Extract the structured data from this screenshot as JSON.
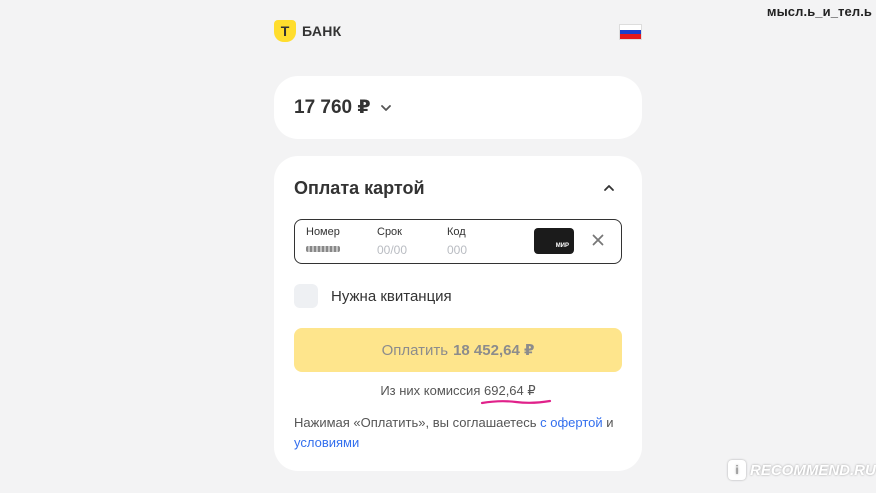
{
  "watermark": "мысл.ь_и_тел.ь",
  "brand": {
    "logo_letter": "Т",
    "name": "БАНК",
    "accent": "#ffdd2d"
  },
  "language": {
    "icon": "russian-flag-icon",
    "colors": [
      "#ffffff",
      "#1c3fcc",
      "#e4181c"
    ]
  },
  "amount": {
    "value": "17 760 ₽",
    "icon": "chevron-down-icon"
  },
  "payment": {
    "title": "Оплата картой",
    "collapse_icon": "chevron-up-icon",
    "card": {
      "number_label": "Номер",
      "term_label": "Срок",
      "term_placeholder": "00/00",
      "code_label": "Код",
      "code_placeholder": "000",
      "card_brand": "МИР",
      "clear_icon": "close-icon"
    },
    "receipt_label": "Нужна квитанция",
    "pay_button": {
      "label": "Оплатить",
      "amount": "18 452,64 ₽",
      "color": "#fee58c"
    },
    "commission": {
      "prefix": "Из них комиссия",
      "amount": "692,64 ₽"
    },
    "terms": {
      "text": "Нажимая «Оплатить», вы соглашаетесь",
      "offer_link": "с офертой",
      "and": "и",
      "conditions_link": "условиями",
      "link_color": "#336fee"
    }
  },
  "recommend_watermark": {
    "icon": "otzovik-icon",
    "text": "RECOMMEND.RU"
  }
}
